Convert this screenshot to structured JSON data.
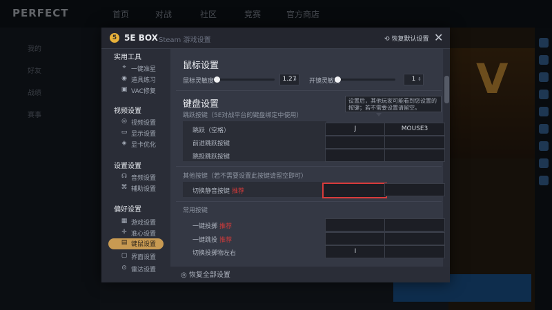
{
  "background": {
    "logo": "PERFECT",
    "nav": [
      "首页",
      "对战",
      "社区",
      "竞赛",
      "官方商店"
    ],
    "left_items": [
      "我的",
      "好友",
      "战绩",
      "赛事"
    ]
  },
  "dialog": {
    "logo_glyph": "5",
    "title": "5E BOX",
    "subtitle": "Steam 游戏设置",
    "reset_label": "恢复默认设置",
    "close_glyph": "✕"
  },
  "sidebar": {
    "sections": [
      {
        "title": "实用工具",
        "items": [
          {
            "icon": "crosshair-icon",
            "glyph": "⌖",
            "label": "一键准星"
          },
          {
            "icon": "grenade-icon",
            "glyph": "◉",
            "label": "道具练习"
          },
          {
            "icon": "vac-icon",
            "glyph": "▣",
            "label": "VAC修复"
          }
        ]
      },
      {
        "title": "视频设置",
        "items": [
          {
            "icon": "display-icon",
            "glyph": "◎",
            "label": "视频设置"
          },
          {
            "icon": "monitor-icon",
            "glyph": "▭",
            "label": "显示设置"
          },
          {
            "icon": "eye-icon",
            "glyph": "◈",
            "label": "显卡优化"
          }
        ]
      },
      {
        "title": "设置设置",
        "items": [
          {
            "icon": "audio-icon",
            "glyph": "☊",
            "label": "音频设置"
          },
          {
            "icon": "gamepad-icon",
            "glyph": "⌘",
            "label": "辅助设置"
          }
        ]
      },
      {
        "title": "偏好设置",
        "items": [
          {
            "icon": "game-icon",
            "glyph": "▦",
            "label": "游戏设置"
          },
          {
            "icon": "crosshair2-icon",
            "glyph": "✛",
            "label": "准心设置"
          },
          {
            "icon": "keyboard-icon",
            "glyph": "▤",
            "label": "键鼠设置",
            "active": true
          },
          {
            "icon": "hud-icon",
            "glyph": "▢",
            "label": "界面设置"
          },
          {
            "icon": "radar-icon",
            "glyph": "⊙",
            "label": "雷达设置"
          }
        ]
      }
    ]
  },
  "mouse": {
    "title": "鼠标设置",
    "sens_label": "鼠标灵敏度",
    "sens_value": "1.27",
    "sens_fraction": 0.05,
    "zoom_label": "开镜灵敏度",
    "zoom_value": "1",
    "zoom_fraction": 0.05
  },
  "keyboard": {
    "title": "键盘设置",
    "tip": "设置后，其他玩家可能看到您设置的按键；若不需要设置请留空。",
    "note1": "跳跃按键（5E对战平台的键盘绑定中使用）",
    "rows1": [
      {
        "label": "跳跃（空格）",
        "key1": "J",
        "key2": "MOUSE3"
      },
      {
        "label": "前进跳跃按键",
        "key1": "",
        "key2": ""
      },
      {
        "label": "跳投跳跃按键",
        "key1": "",
        "key2": ""
      }
    ],
    "note2": "其他按键（若不需要设置此按键请留空即可）",
    "rows2": [
      {
        "label": "切换静音按键",
        "mark": "推荐",
        "key1": "",
        "key2": ""
      }
    ],
    "section3": "常用按键",
    "rows3": [
      {
        "label": "一键投掷",
        "mark": "推荐",
        "key1": "",
        "key2": ""
      },
      {
        "label": "一键跳投",
        "mark": "推荐",
        "key1": "",
        "key2": ""
      },
      {
        "label": "切换投掷物左右",
        "mark": "",
        "key1": "I",
        "key2": ""
      }
    ]
  },
  "footer": {
    "label": "◎ 恢复全部设置"
  }
}
